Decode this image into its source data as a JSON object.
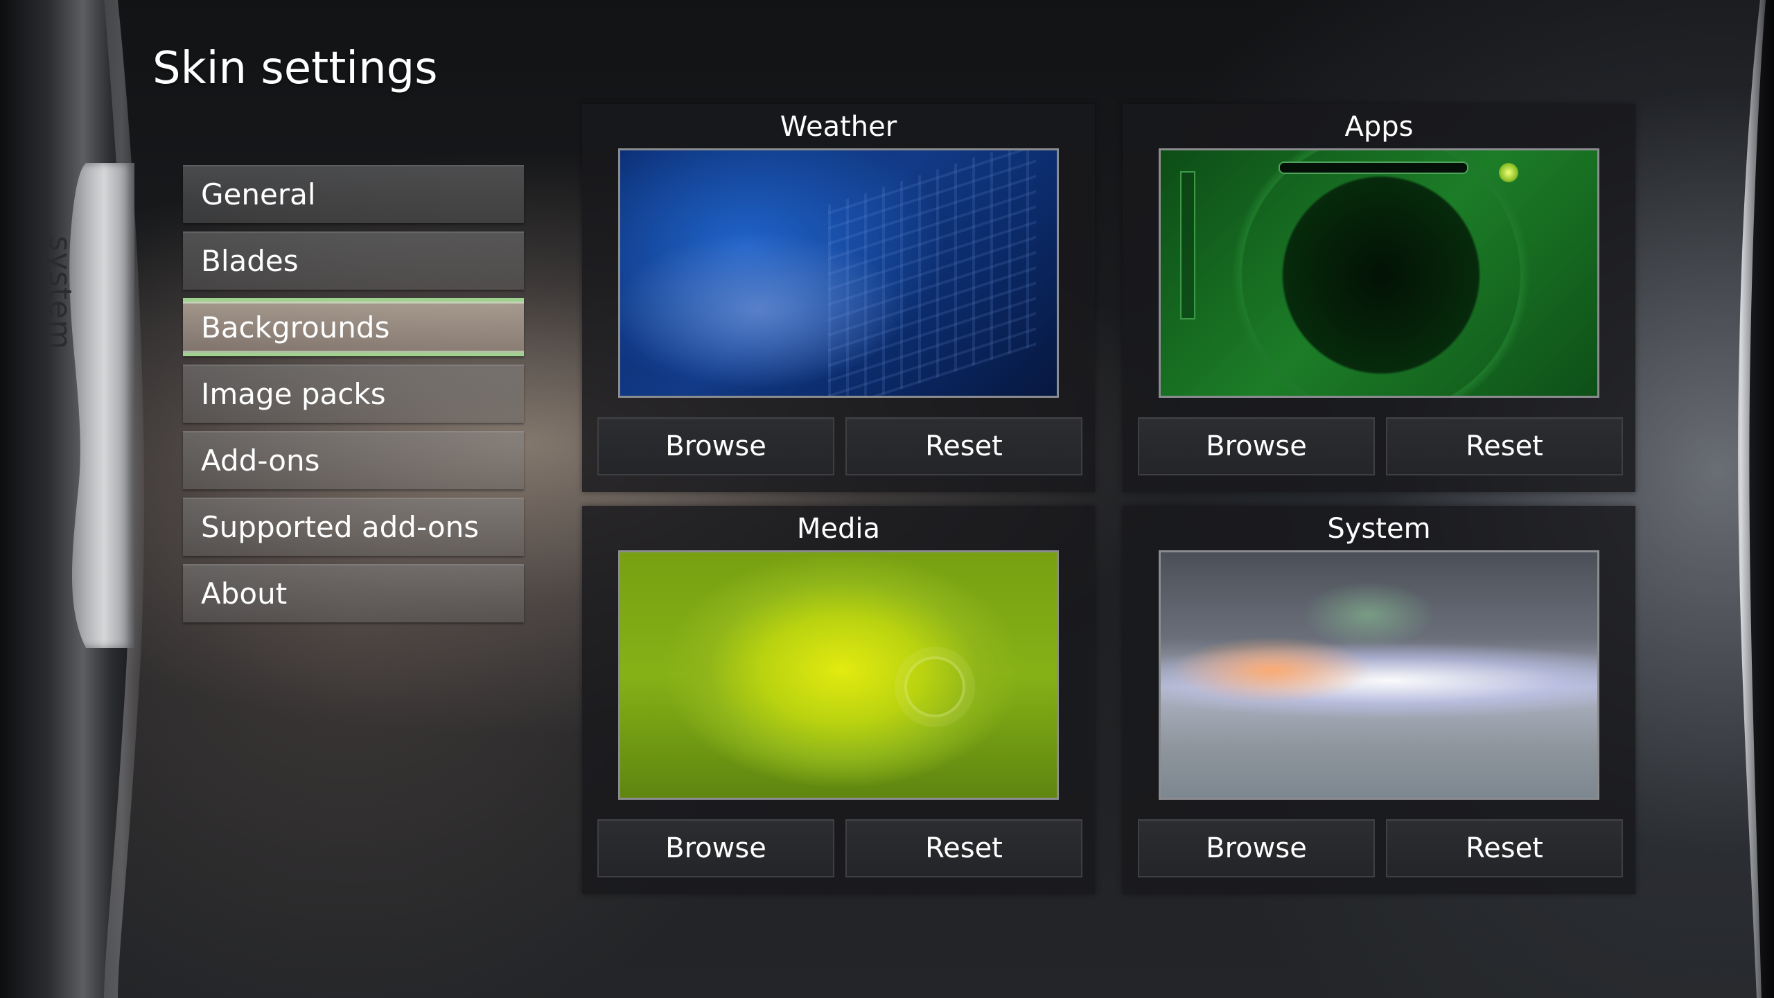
{
  "sidebar_tab": {
    "label": "system"
  },
  "page": {
    "title": "Skin settings"
  },
  "menu": {
    "items": [
      {
        "label": "General",
        "selected": false
      },
      {
        "label": "Blades",
        "selected": false
      },
      {
        "label": "Backgrounds",
        "selected": true
      },
      {
        "label": "Image packs",
        "selected": false
      },
      {
        "label": "Add-ons",
        "selected": false
      },
      {
        "label": "Supported add-ons",
        "selected": false
      },
      {
        "label": "About",
        "selected": false
      }
    ]
  },
  "panels": [
    {
      "title": "Weather",
      "browse_label": "Browse",
      "reset_label": "Reset"
    },
    {
      "title": "Apps",
      "browse_label": "Browse",
      "reset_label": "Reset"
    },
    {
      "title": "Media",
      "browse_label": "Browse",
      "reset_label": "Reset"
    },
    {
      "title": "System",
      "browse_label": "Browse",
      "reset_label": "Reset"
    }
  ],
  "colors": {
    "selection_highlight": "#9fd18f",
    "panel_background": "#18191c",
    "button_background": "#2c2d30"
  }
}
